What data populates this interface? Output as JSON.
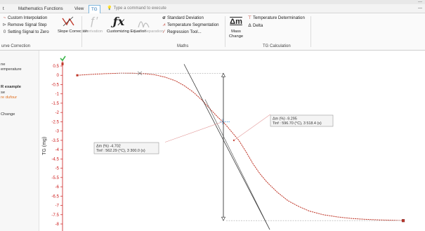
{
  "window": {
    "controls": "—"
  },
  "menu": {
    "tabs": [
      {
        "label": "t"
      },
      {
        "label": "Mathematics Functions"
      },
      {
        "label": "View"
      },
      {
        "label": "TG",
        "active": true
      }
    ],
    "command_placeholder": "Type a command to execute",
    "pin": "—"
  },
  "ribbon": {
    "curve_correction": {
      "items": [
        "Custom Interpolation",
        "Remove Signal Step",
        "Setting Signal to Zero"
      ],
      "slope_correction": "Slope Correction",
      "label": "urve Correction"
    },
    "maths": {
      "derivation": "Derivation",
      "customizing_equation": "Customizing Equation",
      "peak_separation": "Peak Separation",
      "items": [
        "Standard Deviation",
        "Temperature Segmentation",
        "Regression Tool..."
      ],
      "label": "Maths"
    },
    "tg_calc": {
      "mass_change": "Mass Change",
      "mass_icon": "Δm",
      "items": [
        "Temperature Determination",
        "Delta"
      ],
      "label": "TG Calculation"
    }
  },
  "sidebar": {
    "items": [
      {
        "text": "ne",
        "style": "normal"
      },
      {
        "text": "emperature",
        "style": "normal"
      },
      {
        "text": "R example",
        "style": "bold"
      },
      {
        "text": "se",
        "style": "normal"
      },
      {
        "text": "re dufour",
        "style": "orange"
      },
      {
        "text": "Change",
        "style": "normal"
      }
    ]
  },
  "accent_colors": {
    "curve": "#c0392b",
    "axis": "#cc1a1a",
    "tab": "#1f6fb0",
    "tangent": "#222222"
  },
  "chart_data": {
    "type": "line",
    "ylabel": "TG (mg)",
    "ylim": [
      -8.3,
      0.6
    ],
    "yticks": [
      "0.5",
      "0",
      "-0.5",
      "-1",
      "-1.5",
      "-2",
      "-2.5",
      "-3",
      "-3.5",
      "-4",
      "-4.5",
      "-5",
      "-5.5",
      "-6",
      "-6.5",
      "-7",
      "-7.5",
      "-8"
    ],
    "ytick_values": [
      0.5,
      0,
      -0.5,
      -1,
      -1.5,
      -2,
      -2.5,
      -3,
      -3.5,
      -4,
      -4.5,
      -5,
      -5.5,
      -6,
      -6.5,
      -7,
      -7.5,
      -8
    ],
    "curve_points": [
      [
        110,
        0.0
      ],
      [
        130,
        0.05
      ],
      [
        150,
        0.09
      ],
      [
        170,
        0.11
      ],
      [
        190,
        0.11
      ],
      [
        205,
        0.09
      ],
      [
        220,
        0.03
      ],
      [
        235,
        -0.1
      ],
      [
        250,
        -0.3
      ],
      [
        262,
        -0.55
      ],
      [
        275,
        -0.9
      ],
      [
        288,
        -1.35
      ],
      [
        300,
        -1.85
      ],
      [
        310,
        -2.25
      ],
      [
        320,
        -2.6
      ],
      [
        330,
        -3.05
      ],
      [
        340,
        -3.5
      ],
      [
        350,
        -4.1
      ],
      [
        360,
        -4.75
      ],
      [
        370,
        -5.3
      ],
      [
        380,
        -5.75
      ],
      [
        395,
        -6.3
      ],
      [
        410,
        -6.75
      ],
      [
        425,
        -7.05
      ],
      [
        440,
        -7.3
      ],
      [
        460,
        -7.5
      ],
      [
        480,
        -7.62
      ],
      [
        500,
        -7.7
      ],
      [
        520,
        -7.75
      ],
      [
        540,
        -7.78
      ],
      [
        560,
        -7.8
      ],
      [
        574,
        -7.82
      ]
    ],
    "annotations": [
      {
        "lines": [
          "Δm (%) -9.295",
          "Tinf : 596.70 (°C), 3 518.4 (s)"
        ]
      },
      {
        "lines": [
          "Δm (%) -4.702",
          "Tinf : 562.29 (°C), 3 300.0 (s)"
        ]
      }
    ]
  }
}
